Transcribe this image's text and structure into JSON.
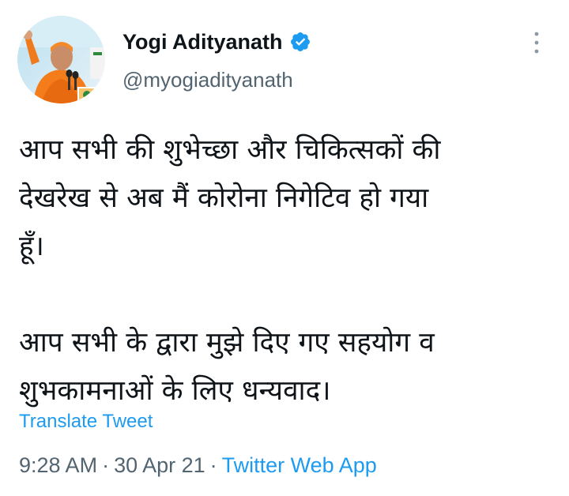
{
  "tweet": {
    "author": {
      "display_name": "Yogi Adityanath",
      "handle": "@myogiadityanath",
      "verified": true,
      "avatar_icon": "profile-photo-avatar",
      "verified_icon": "verified-badge-icon"
    },
    "more_icon": "more-options-icon",
    "text_lines": [
      "आप सभी की शुभेच्छा और चिकित्सकों की",
      "देखरेख से अब मैं कोरोना निगेटिव हो गया",
      "हूँ।",
      "आप सभी के द्वारा मुझे दिए गए सहयोग व",
      "शुभकामनाओं के लिए धन्यवाद।"
    ],
    "translate_label": "Translate Tweet",
    "time": "9:28 AM",
    "date": "30 Apr 21",
    "separator": "·",
    "source": "Twitter Web App"
  },
  "colors": {
    "text": "#0f1419",
    "secondary": "#536471",
    "link": "#1d9bf0",
    "verified": "#1d9bf0"
  }
}
